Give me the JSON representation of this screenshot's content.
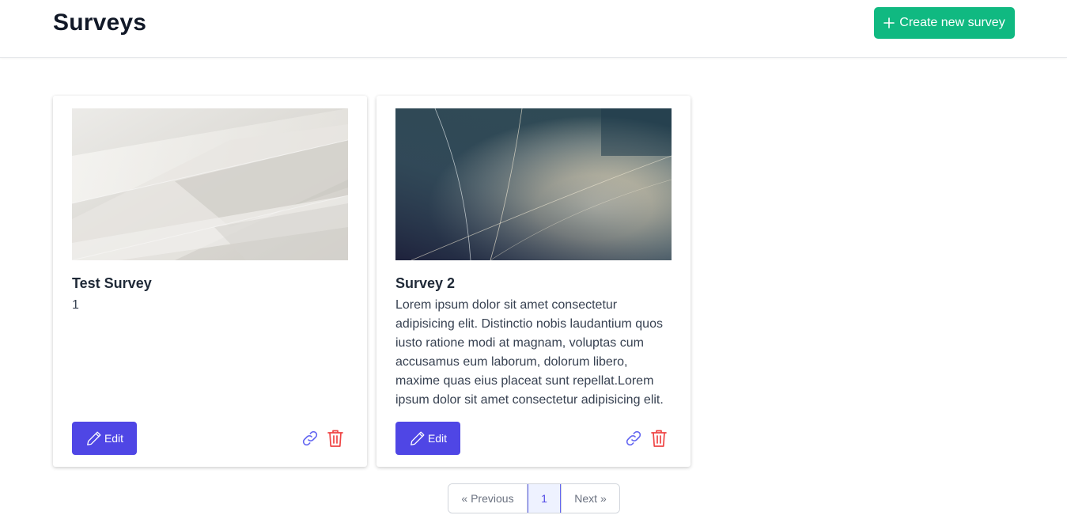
{
  "header": {
    "title": "Surveys",
    "create_button": "Create new survey"
  },
  "surveys": [
    {
      "title": "Test Survey",
      "description": "1",
      "edit_label": "Edit",
      "image": "soft white translucent fabric folds"
    },
    {
      "title": "Survey 2",
      "description": "Lorem ipsum dolor sit amet consectetur adipisicing elit. Distinctio nobis laudantium quos iusto ratione modi at magnam, voluptas cum accusamus eum laborum, dolorum libero, maxime quas eius placeat sunt repellat.Lorem ipsum dolor sit amet consectetur adipisicing elit.",
      "edit_label": "Edit",
      "image": "dark teal and cream bokeh abstract with light streaks"
    }
  ],
  "pagination": {
    "previous": "« Previous",
    "current_page": "1",
    "next": "Next »"
  },
  "colors": {
    "create_button": "#10b981",
    "edit_button": "#4f46e5",
    "link_icon": "#6366f1",
    "delete_icon": "#ef4444",
    "active_page_border": "#6366f1"
  },
  "icons": {
    "create": "plus-icon",
    "edit": "pencil-icon",
    "share": "link-icon",
    "delete": "trash-icon"
  }
}
